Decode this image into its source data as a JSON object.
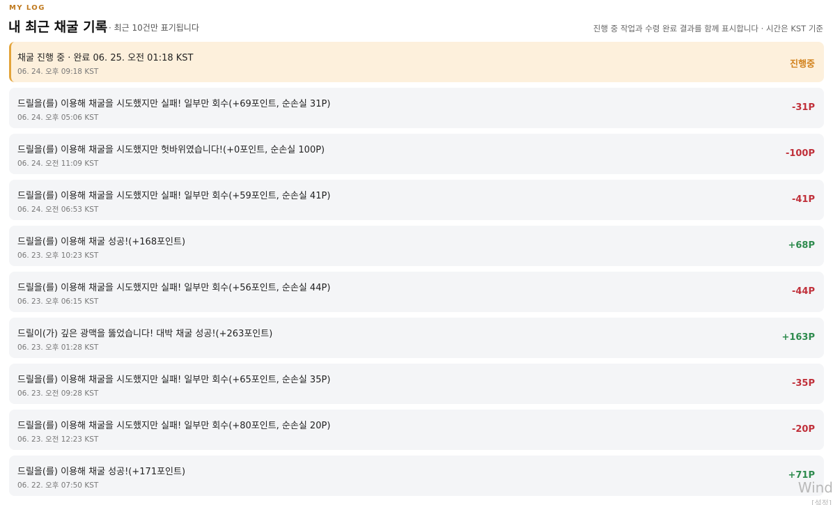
{
  "header": {
    "eyebrow": "MY LOG",
    "title": "내 최근 채굴 기록",
    "subnote": "· 최근 10건만 표기됩니다",
    "help": "진행 중 작업과 수령 완료 결과를 함께 표시합니다 · 시간은 KST 기준"
  },
  "colors": {
    "accent": "#c07a1e",
    "active_bg": "#fdf0dc",
    "active_border": "#e3a43a",
    "negative": "#c0303a",
    "positive": "#2e8b4e",
    "pending": "#d2831e",
    "row_bg": "#f4f5f7"
  },
  "logs": [
    {
      "text": "채굴 진행 중 · 완료 06. 25. 오전 01:18 KST",
      "time": "06. 24. 오후 09:18 KST",
      "amount": "진행중",
      "status": "pending"
    },
    {
      "text": "드릴을(를) 이용해 채굴을 시도했지만 실패! 일부만 회수(+69포인트, 순손실 31P)",
      "time": "06. 24. 오후 05:06 KST",
      "amount": "-31P",
      "status": "negative"
    },
    {
      "text": "드릴을(를) 이용해 채굴을 시도했지만 헛바위였습니다!(+0포인트, 순손실 100P)",
      "time": "06. 24. 오전 11:09 KST",
      "amount": "-100P",
      "status": "negative"
    },
    {
      "text": "드릴을(를) 이용해 채굴을 시도했지만 실패! 일부만 회수(+59포인트, 순손실 41P)",
      "time": "06. 24. 오전 06:53 KST",
      "amount": "-41P",
      "status": "negative"
    },
    {
      "text": "드릴을(를) 이용해 채굴 성공!(+168포인트)",
      "time": "06. 23. 오후 10:23 KST",
      "amount": "+68P",
      "status": "positive"
    },
    {
      "text": "드릴을(를) 이용해 채굴을 시도했지만 실패! 일부만 회수(+56포인트, 순손실 44P)",
      "time": "06. 23. 오후 06:15 KST",
      "amount": "-44P",
      "status": "negative"
    },
    {
      "text": "드릴이(가) 깊은 광맥을 뚫었습니다! 대박 채굴 성공!(+263포인트)",
      "time": "06. 23. 오후 01:28 KST",
      "amount": "+163P",
      "status": "positive"
    },
    {
      "text": "드릴을(를) 이용해 채굴을 시도했지만 실패! 일부만 회수(+65포인트, 순손실 35P)",
      "time": "06. 23. 오전 09:28 KST",
      "amount": "-35P",
      "status": "negative"
    },
    {
      "text": "드릴을(를) 이용해 채굴을 시도했지만 실패! 일부만 회수(+80포인트, 순손실 20P)",
      "time": "06. 23. 오전 12:23 KST",
      "amount": "-20P",
      "status": "negative"
    },
    {
      "text": "드릴을(를) 이용해 채굴 성공!(+171포인트)",
      "time": "06. 22. 오후 07:50 KST",
      "amount": "+71P",
      "status": "positive"
    }
  ],
  "watermark": {
    "line1": "Wind",
    "line2": "[설정]"
  }
}
